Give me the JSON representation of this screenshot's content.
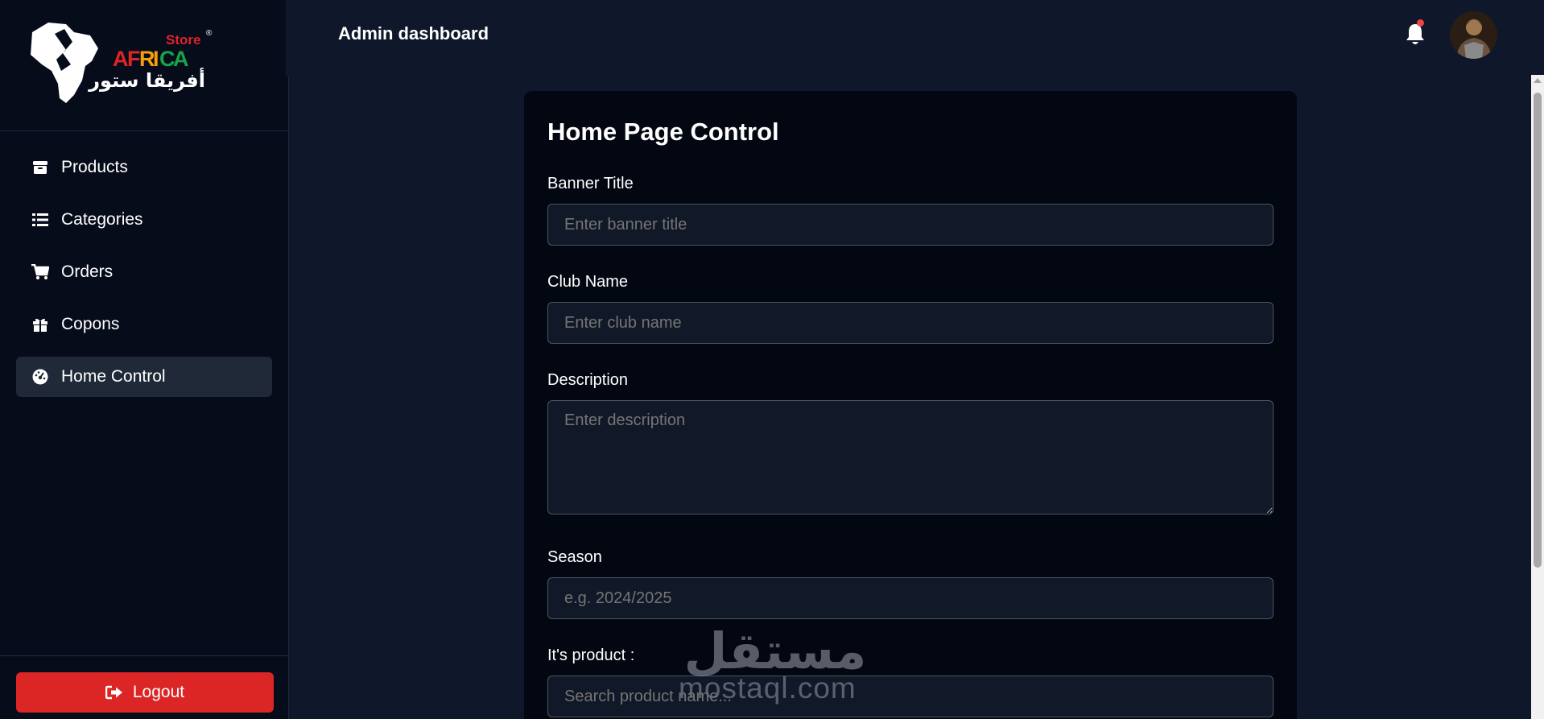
{
  "brand": {
    "store": "Store",
    "registered": "®",
    "name_letters": [
      "A",
      "F",
      "R",
      "I",
      "C",
      "A"
    ],
    "name_colors": [
      "#dc2626",
      "#dc2626",
      "#f59e0b",
      "#f59e0b",
      "#16a34a",
      "#16a34a"
    ],
    "arabic": "أفريقا ستور",
    "store_color": "#dc2626"
  },
  "sidebar": {
    "items": [
      {
        "label": "Products",
        "icon": "box-icon",
        "active": false
      },
      {
        "label": "Categories",
        "icon": "list-icon",
        "active": false
      },
      {
        "label": "Orders",
        "icon": "cart-icon",
        "active": false
      },
      {
        "label": "Copons",
        "icon": "gift-icon",
        "active": false
      },
      {
        "label": "Home Control",
        "icon": "gauge-icon",
        "active": true
      }
    ],
    "logout_label": "Logout",
    "logout_color": "#dc2626"
  },
  "header": {
    "title": "Admin dashboard",
    "notification_dot_color": "#ef4444"
  },
  "form": {
    "title": "Home Page Control",
    "banner_title": {
      "label": "Banner Title",
      "placeholder": "Enter banner title"
    },
    "club_name": {
      "label": "Club Name",
      "placeholder": "Enter club name"
    },
    "description": {
      "label": "Description",
      "placeholder": "Enter description"
    },
    "season": {
      "label": "Season",
      "placeholder": "e.g. 2024/2025"
    },
    "product": {
      "label": "It's product :",
      "placeholder": "Search product name..."
    }
  },
  "watermark": {
    "arabic": "مستقل",
    "latin": "mostaql.com"
  }
}
